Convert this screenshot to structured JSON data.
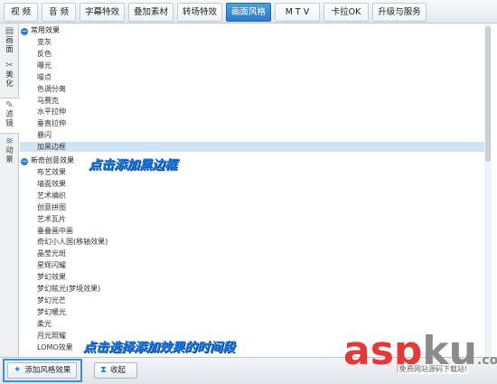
{
  "tabs": [
    {
      "label": "视  频"
    },
    {
      "label": "音  频"
    },
    {
      "label": "字幕特效"
    },
    {
      "label": "叠加素材"
    },
    {
      "label": "转场特效"
    },
    {
      "label": "画面风格",
      "active": true
    },
    {
      "label": "M T V"
    },
    {
      "label": "卡拉OK"
    },
    {
      "label": "升级与服务"
    }
  ],
  "sidebar": [
    {
      "icon": "picture-icon",
      "label1": "画",
      "label2": "面"
    },
    {
      "icon": "beautify-icon",
      "label1": "美",
      "label2": "化"
    },
    {
      "icon": "filter-icon",
      "label1": "滤",
      "label2": "镜",
      "active": true
    },
    {
      "icon": "motion-icon",
      "label1": "动",
      "label2": "景"
    }
  ],
  "groups": [
    {
      "title": "常用效果",
      "items": [
        "变灰",
        "反色",
        "曝光",
        "噪点",
        "色调分离",
        "马赛克",
        "水平拉伸",
        "垂直拉伸",
        "暴闪",
        "加黑边框"
      ]
    },
    {
      "title": "新奇创意效果",
      "items": [
        "布艺效果",
        "墙面效果",
        "艺术编织",
        "创意拼图",
        "艺术瓦片",
        "垂叠画中画",
        "奇幻小人国(移轴效果)",
        "晶莹光斑",
        "星辉闪耀",
        "梦幻效果",
        "梦幻眩光(梦境效果)",
        "梦幻光芒",
        "梦幻暖光",
        "柔光",
        "月光照耀",
        "LOMO效果"
      ]
    }
  ],
  "selected_item": "加黑边框",
  "annotations": {
    "top": "点击添加黑边框",
    "bottom": "点击选择添加效果的时间段"
  },
  "watermark": {
    "part1": "asp",
    "part2": "ku",
    "part3": ".com",
    "sub": "免费网站源码下载站!"
  },
  "buttons": {
    "add": "添加风格效果",
    "collapse": "收起"
  },
  "colors": {
    "accent": "#2a7bca",
    "selection": "#cfe4f6",
    "annotation": "#1f7be0",
    "watermark": "#e23a3a"
  }
}
